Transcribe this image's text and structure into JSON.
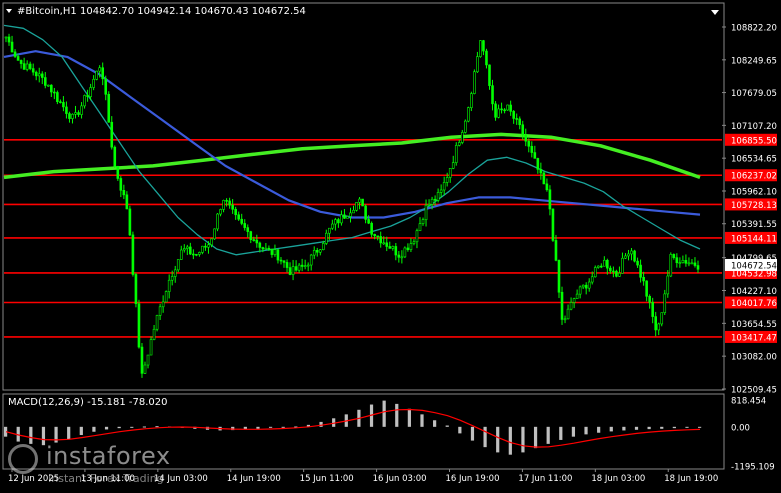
{
  "header": {
    "symbol": "#Bitcoin,H1",
    "ohlc": "104842.70 104942.14 104670.43 104672.54"
  },
  "colors": {
    "background": "#000000",
    "candle": "#00ff00",
    "ma_fast": "#1aa39a",
    "ma_mid": "#3b5bdb",
    "ma_slow": "#44ee22",
    "level_line": "#ff0000",
    "macd_hist": "#c0c0c0",
    "macd_signal": "#ff0000"
  },
  "chart_data": {
    "type": "line",
    "price_axis": {
      "ylim": [
        102509.45,
        108822.2
      ],
      "ticks": [
        "108822.20",
        "108249.65",
        "107679.05",
        "107107.20",
        "106534.65",
        "105962.10",
        "105391.55",
        "104799.65",
        "104227.10",
        "103654.55",
        "103082.00",
        "102509.45"
      ]
    },
    "time_axis": {
      "ticks": [
        "12 Jun 2025",
        "13 Jun 11:00",
        "14 Jun 03:00",
        "14 Jun 19:00",
        "15 Jun 11:00",
        "16 Jun 03:00",
        "16 Jun 19:00",
        "17 Jun 11:00",
        "18 Jun 03:00",
        "18 Jun 19:00"
      ]
    },
    "levels": [
      {
        "label": "106855.50",
        "value": 106855.5
      },
      {
        "label": "106237.02",
        "value": 106237.02
      },
      {
        "label": "105728.13",
        "value": 105728.13
      },
      {
        "label": "105144.11",
        "value": 105144.11
      },
      {
        "label": "104532.98",
        "value": 104532.98
      },
      {
        "label": "104017.76",
        "value": 104017.76
      },
      {
        "label": "103417.47",
        "value": 103417.47
      }
    ],
    "current_price": {
      "label": "104672.54",
      "value": 104672.54
    },
    "close_series": [
      108650,
      108200,
      108050,
      107850,
      107500,
      107200,
      107650,
      108200,
      106400,
      105600,
      102700,
      103650,
      104400,
      104950,
      104850,
      105050,
      105850,
      105450,
      105200,
      104950,
      104850,
      104550,
      104650,
      104950,
      105350,
      105550,
      105800,
      105250,
      105050,
      104850,
      105100,
      105700,
      105900,
      106550,
      107350,
      108650,
      107300,
      107400,
      107000,
      106450,
      105850,
      103650,
      104150,
      104400,
      104750,
      104500,
      105000,
      104350,
      103450,
      104800,
      104750,
      104672.54
    ],
    "ma_fast": [
      108850,
      108800,
      108600,
      108300,
      107800,
      107300,
      106800,
      106300,
      105900,
      105500,
      105200,
      104950,
      104850,
      104900,
      104950,
      105000,
      105050,
      105100,
      105150,
      105250,
      105350,
      105500,
      105700,
      105950,
      106250,
      106500,
      106550,
      106450,
      106300,
      106200,
      106100,
      105950,
      105700,
      105500,
      105300,
      105100,
      104950
    ],
    "ma_mid": [
      108300,
      108400,
      108300,
      108000,
      107600,
      107200,
      106800,
      106400,
      106100,
      105800,
      105600,
      105500,
      105500,
      105600,
      105750,
      105850,
      105850,
      105800,
      105750,
      105700,
      105650,
      105600,
      105550
    ],
    "ma_slow": [
      106200,
      106300,
      106350,
      106400,
      106500,
      106600,
      106700,
      106750,
      106800,
      106900,
      106950,
      106900,
      106750,
      106500,
      106200
    ],
    "macd": {
      "label": "MACD(12,26,9) -15.181 -78.020",
      "ylim": [
        -1195.109,
        818.454
      ],
      "ticks": [
        "818.454",
        "0.00",
        "-1195.109"
      ],
      "histogram": [
        -300,
        -450,
        -520,
        -560,
        -480,
        -380,
        -250,
        -150,
        -80,
        -40,
        -10,
        10,
        20,
        10,
        -20,
        -60,
        -90,
        -110,
        -100,
        -80,
        -60,
        -30,
        -10,
        10,
        60,
        150,
        260,
        380,
        520,
        680,
        800,
        700,
        550,
        380,
        200,
        40,
        -200,
        -420,
        -620,
        -780,
        -850,
        -780,
        -650,
        -520,
        -400,
        -300,
        -230,
        -180,
        -140,
        -110,
        -90,
        -70,
        -60,
        -40,
        -20,
        -15
      ],
      "signal": [
        -150,
        -250,
        -330,
        -390,
        -400,
        -380,
        -330,
        -270,
        -210,
        -150,
        -100,
        -60,
        -30,
        -10,
        -5,
        -15,
        -35,
        -55,
        -70,
        -75,
        -75,
        -65,
        -50,
        -30,
        0,
        50,
        110,
        180,
        260,
        360,
        460,
        520,
        530,
        500,
        430,
        340,
        200,
        30,
        -150,
        -330,
        -480,
        -580,
        -620,
        -610,
        -560,
        -500,
        -430,
        -360,
        -300,
        -250,
        -200,
        -160,
        -130,
        -110,
        -90,
        -78
      ]
    }
  },
  "logo": {
    "name": "instaforex",
    "tagline": "Instant Forex Trading"
  }
}
